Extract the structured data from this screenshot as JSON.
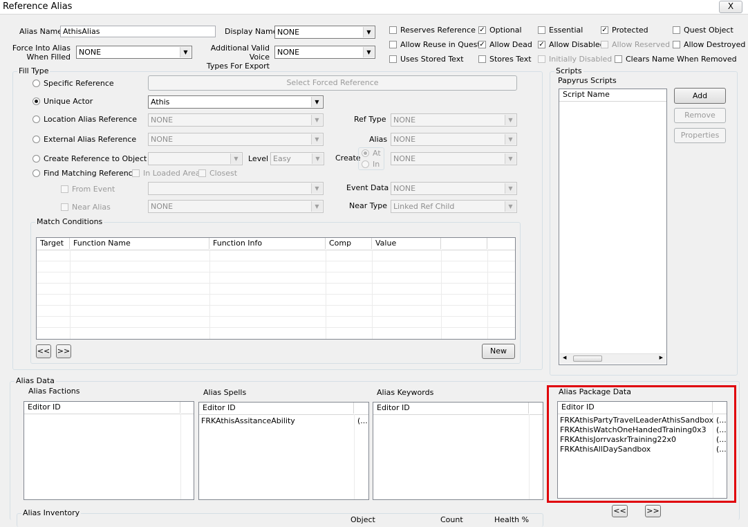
{
  "window": {
    "title": "Reference Alias",
    "close_glyph": "X"
  },
  "alias_name": {
    "label": "Alias Name",
    "value": "AthisAlias"
  },
  "display_name": {
    "label": "Display Name",
    "value": "NONE"
  },
  "force_into_alias": {
    "label_line1": "Force Into Alias",
    "label_line2": "When Filled",
    "value": "NONE"
  },
  "voice_types": {
    "label_line1": "Additional Valid Voice",
    "label_line2": "Types For Export",
    "value": "NONE"
  },
  "flags": {
    "reserves_reference": "Reserves Reference",
    "optional": "Optional",
    "essential": "Essential",
    "protected": "Protected",
    "quest_object": "Quest Object",
    "allow_reuse": "Allow Reuse in Quest",
    "allow_dead": "Allow Dead",
    "allow_disabled": "Allow Disabled",
    "allow_reserved": "Allow Reserved",
    "allow_destroyed": "Allow Destroyed",
    "uses_stored_text": "Uses Stored Text",
    "stores_text": "Stores Text",
    "initially_disabled": "Initially Disabled",
    "clears_name": "Clears Name When Removed"
  },
  "fill_type": {
    "title": "Fill Type",
    "specific_reference": "Specific Reference",
    "select_forced_button": "Select Forced Reference",
    "unique_actor": "Unique Actor",
    "unique_actor_value": "Athis",
    "location_alias": "Location Alias Reference",
    "location_alias_value": "NONE",
    "ref_type_label": "Ref Type",
    "ref_type_value": "NONE",
    "external_alias": "External Alias Reference",
    "external_alias_value": "NONE",
    "alias_label": "Alias",
    "alias_value": "NONE",
    "create_reference": "Create Reference to Object",
    "level_label": "Level",
    "level_value": "Easy",
    "create_label": "Create",
    "create_at": "At",
    "create_in": "In",
    "create_value": "NONE",
    "find_matching": "Find Matching Reference",
    "in_loaded_area": "In Loaded Area",
    "closest": "Closest",
    "from_event": "From Event",
    "event_data_label": "Event Data",
    "event_data_value": "NONE",
    "near_alias": "Near Alias",
    "near_alias_value": "NONE",
    "near_type_label": "Near Type",
    "near_type_value": "Linked Ref Child"
  },
  "match_conditions": {
    "title": "Match Conditions",
    "columns": [
      "Target",
      "Function Name",
      "Function Info",
      "Comp",
      "Value"
    ],
    "prev_button": "<<",
    "next_button": ">>",
    "new_button": "New"
  },
  "scripts": {
    "title": "Scripts",
    "subtitle": "Papyrus Scripts",
    "column": "Script Name",
    "add_button": "Add",
    "remove_button": "Remove",
    "properties_button": "Properties"
  },
  "alias_data": {
    "title": "Alias Data",
    "factions": {
      "title": "Alias Factions",
      "column": "Editor ID",
      "rows": []
    },
    "spells": {
      "title": "Alias Spells",
      "column": "Editor ID",
      "rows": [
        {
          "id": "FRKAthisAssitanceAbility",
          "extra": "(..."
        }
      ]
    },
    "keywords": {
      "title": "Alias Keywords",
      "column": "Editor ID",
      "rows": []
    },
    "packages": {
      "title": "Alias Package Data",
      "column": "Editor ID",
      "rows": [
        {
          "id": "FRKAthisPartyTravelLeaderAthisSandbox",
          "extra": "(..."
        },
        {
          "id": "FRKAthisWatchOneHandedTraining0x3",
          "extra": "(..."
        },
        {
          "id": "FRKAthisJorrvaskrTraining22x0",
          "extra": "(..."
        },
        {
          "id": "FRKAthisAllDaySandbox",
          "extra": "(..."
        }
      ],
      "prev_button": "<<",
      "next_button": ">>"
    },
    "highlight_color": "#e0000a"
  },
  "inventory": {
    "title": "Alias Inventory",
    "col_object": "Object",
    "col_count": "Count",
    "col_health": "Health %"
  }
}
